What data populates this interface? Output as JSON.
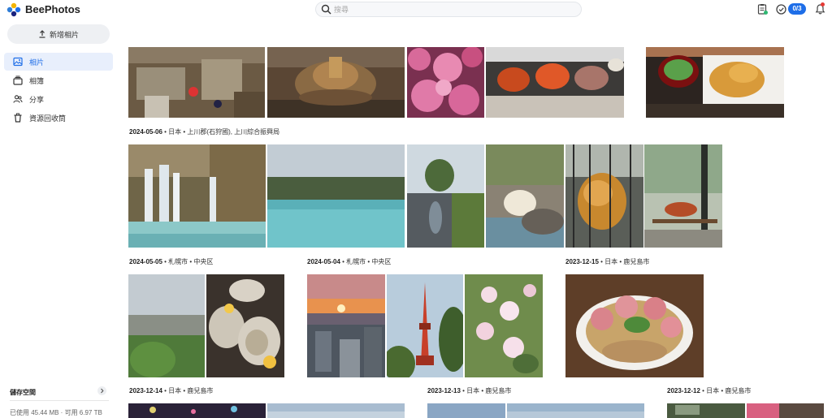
{
  "header": {
    "app_name": "BeePhotos",
    "search_placeholder": "搜尋",
    "task_badge": "0/3"
  },
  "sidebar": {
    "upload_label": "新增相片",
    "items": [
      {
        "label": "相片",
        "icon": "photo-icon",
        "active": true
      },
      {
        "label": "相簿",
        "icon": "album-icon",
        "active": false
      },
      {
        "label": "分享",
        "icon": "share-icon",
        "active": false
      },
      {
        "label": "資源回收筒",
        "icon": "trash-icon",
        "active": false
      }
    ],
    "storage": {
      "title": "儲存空間",
      "used": "已使用 45.44 MB · 可用 6.97 TB"
    }
  },
  "groups": [
    {
      "date": "2024-05-06",
      "place": " • 日本 • 上川郡(石狩國), 上川綜合振興局"
    },
    {
      "date": "2024-05-05",
      "place": " • 札幌市 • 中央区"
    },
    {
      "date": "2024-05-04",
      "place": " • 札幌市 • 中央区"
    },
    {
      "date": "2023-12-15",
      "place": " • 日本 • 鹿兒島市"
    },
    {
      "date": "2023-12-14",
      "place": " • 日本 • 鹿兒島市"
    },
    {
      "date": "2023-12-13",
      "place": " • 日本 • 鹿兒島市"
    },
    {
      "date": "2023-12-12",
      "place": " • 日本 • 鹿兒島市"
    }
  ],
  "colors": {
    "accent": "#1e6ee8",
    "active_nav_bg": "#e8effc",
    "notification": "#e53935"
  }
}
